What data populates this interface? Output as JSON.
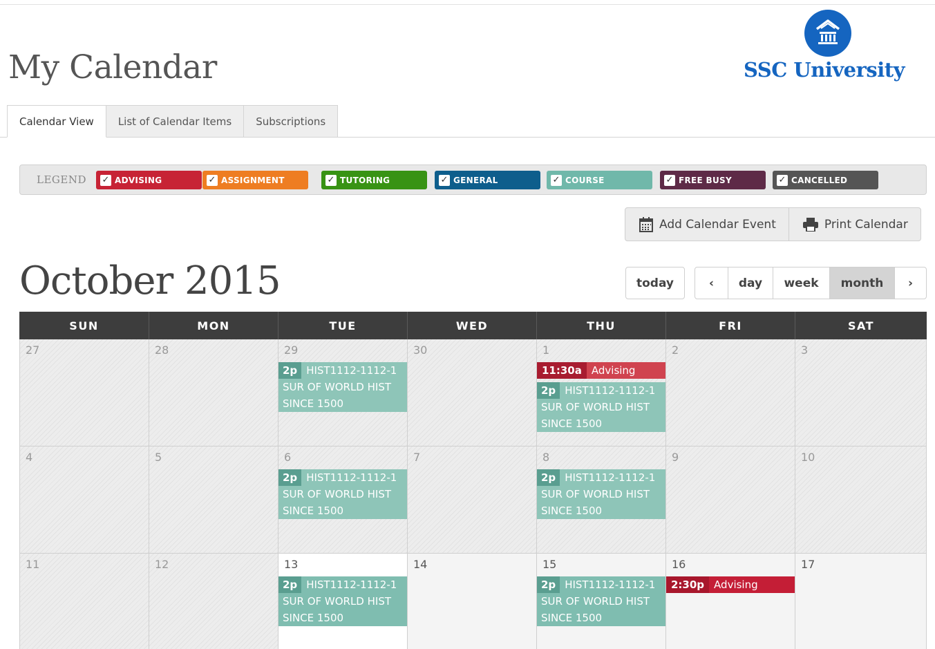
{
  "header": {
    "title": "My Calendar",
    "logo_text": "SSC University"
  },
  "tabs": [
    {
      "label": "Calendar View",
      "active": true
    },
    {
      "label": "List of Calendar Items",
      "active": false
    },
    {
      "label": "Subscriptions",
      "active": false
    }
  ],
  "legend": {
    "title": "LEGEND",
    "items": [
      {
        "label": "ADVISING",
        "color": "#c72335",
        "checked": true
      },
      {
        "label": "ASSIGNMENT",
        "color": "#ee7d22",
        "checked": true
      },
      {
        "label": "TUTORING",
        "color": "#389314",
        "checked": true
      },
      {
        "label": "GENERAL",
        "color": "#0e5e8c",
        "checked": true
      },
      {
        "label": "COURSE",
        "color": "#70b8aa",
        "checked": true
      },
      {
        "label": "FREE BUSY",
        "color": "#5e2a47",
        "checked": true
      },
      {
        "label": "CANCELLED",
        "color": "#555555",
        "checked": true
      }
    ]
  },
  "actions": {
    "add_label": "Add Calendar Event",
    "print_label": "Print Calendar"
  },
  "calendar": {
    "month_title": "October 2015",
    "today_label": "today",
    "prev_icon": "‹",
    "next_icon": "›",
    "views": [
      {
        "label": "day",
        "active": false
      },
      {
        "label": "week",
        "active": false
      },
      {
        "label": "month",
        "active": true
      }
    ],
    "weekdays": [
      "SUN",
      "MON",
      "TUE",
      "WED",
      "THU",
      "FRI",
      "SAT"
    ],
    "weeks": [
      {
        "days": [
          {
            "num": "27",
            "state": "past"
          },
          {
            "num": "28",
            "state": "past"
          },
          {
            "num": "29",
            "state": "past",
            "events": [
              {
                "type": "course",
                "time": "2p",
                "title": "HIST1112-1112-1 SUR OF WORLD HIST SINCE 1500"
              }
            ]
          },
          {
            "num": "30",
            "state": "past"
          },
          {
            "num": "1",
            "state": "past",
            "events": [
              {
                "type": "advising",
                "time": "11:30a",
                "title": "Advising"
              },
              {
                "type": "course",
                "time": "2p",
                "title": "HIST1112-1112-1 SUR OF WORLD HIST SINCE 1500"
              }
            ]
          },
          {
            "num": "2",
            "state": "past"
          },
          {
            "num": "3",
            "state": "past"
          }
        ]
      },
      {
        "days": [
          {
            "num": "4",
            "state": "past"
          },
          {
            "num": "5",
            "state": "past"
          },
          {
            "num": "6",
            "state": "past",
            "events": [
              {
                "type": "course",
                "time": "2p",
                "title": "HIST1112-1112-1 SUR OF WORLD HIST SINCE 1500"
              }
            ]
          },
          {
            "num": "7",
            "state": "past"
          },
          {
            "num": "8",
            "state": "past",
            "events": [
              {
                "type": "course",
                "time": "2p",
                "title": "HIST1112-1112-1 SUR OF WORLD HIST SINCE 1500"
              }
            ]
          },
          {
            "num": "9",
            "state": "past"
          },
          {
            "num": "10",
            "state": "past"
          }
        ]
      },
      {
        "days": [
          {
            "num": "11",
            "state": "past"
          },
          {
            "num": "12",
            "state": "past"
          },
          {
            "num": "13",
            "state": "today",
            "events": [
              {
                "type": "course",
                "time": "2p",
                "title": "HIST1112-1112-1 SUR OF WORLD HIST SINCE 1500"
              }
            ]
          },
          {
            "num": "14",
            "state": "future"
          },
          {
            "num": "15",
            "state": "future",
            "events": [
              {
                "type": "course",
                "time": "2p",
                "title": "HIST1112-1112-1 SUR OF WORLD HIST SINCE 1500"
              }
            ]
          },
          {
            "num": "16",
            "state": "future",
            "events": [
              {
                "type": "advising",
                "time": "2:30p",
                "title": "Advising"
              }
            ]
          },
          {
            "num": "17",
            "state": "future"
          }
        ]
      }
    ]
  }
}
